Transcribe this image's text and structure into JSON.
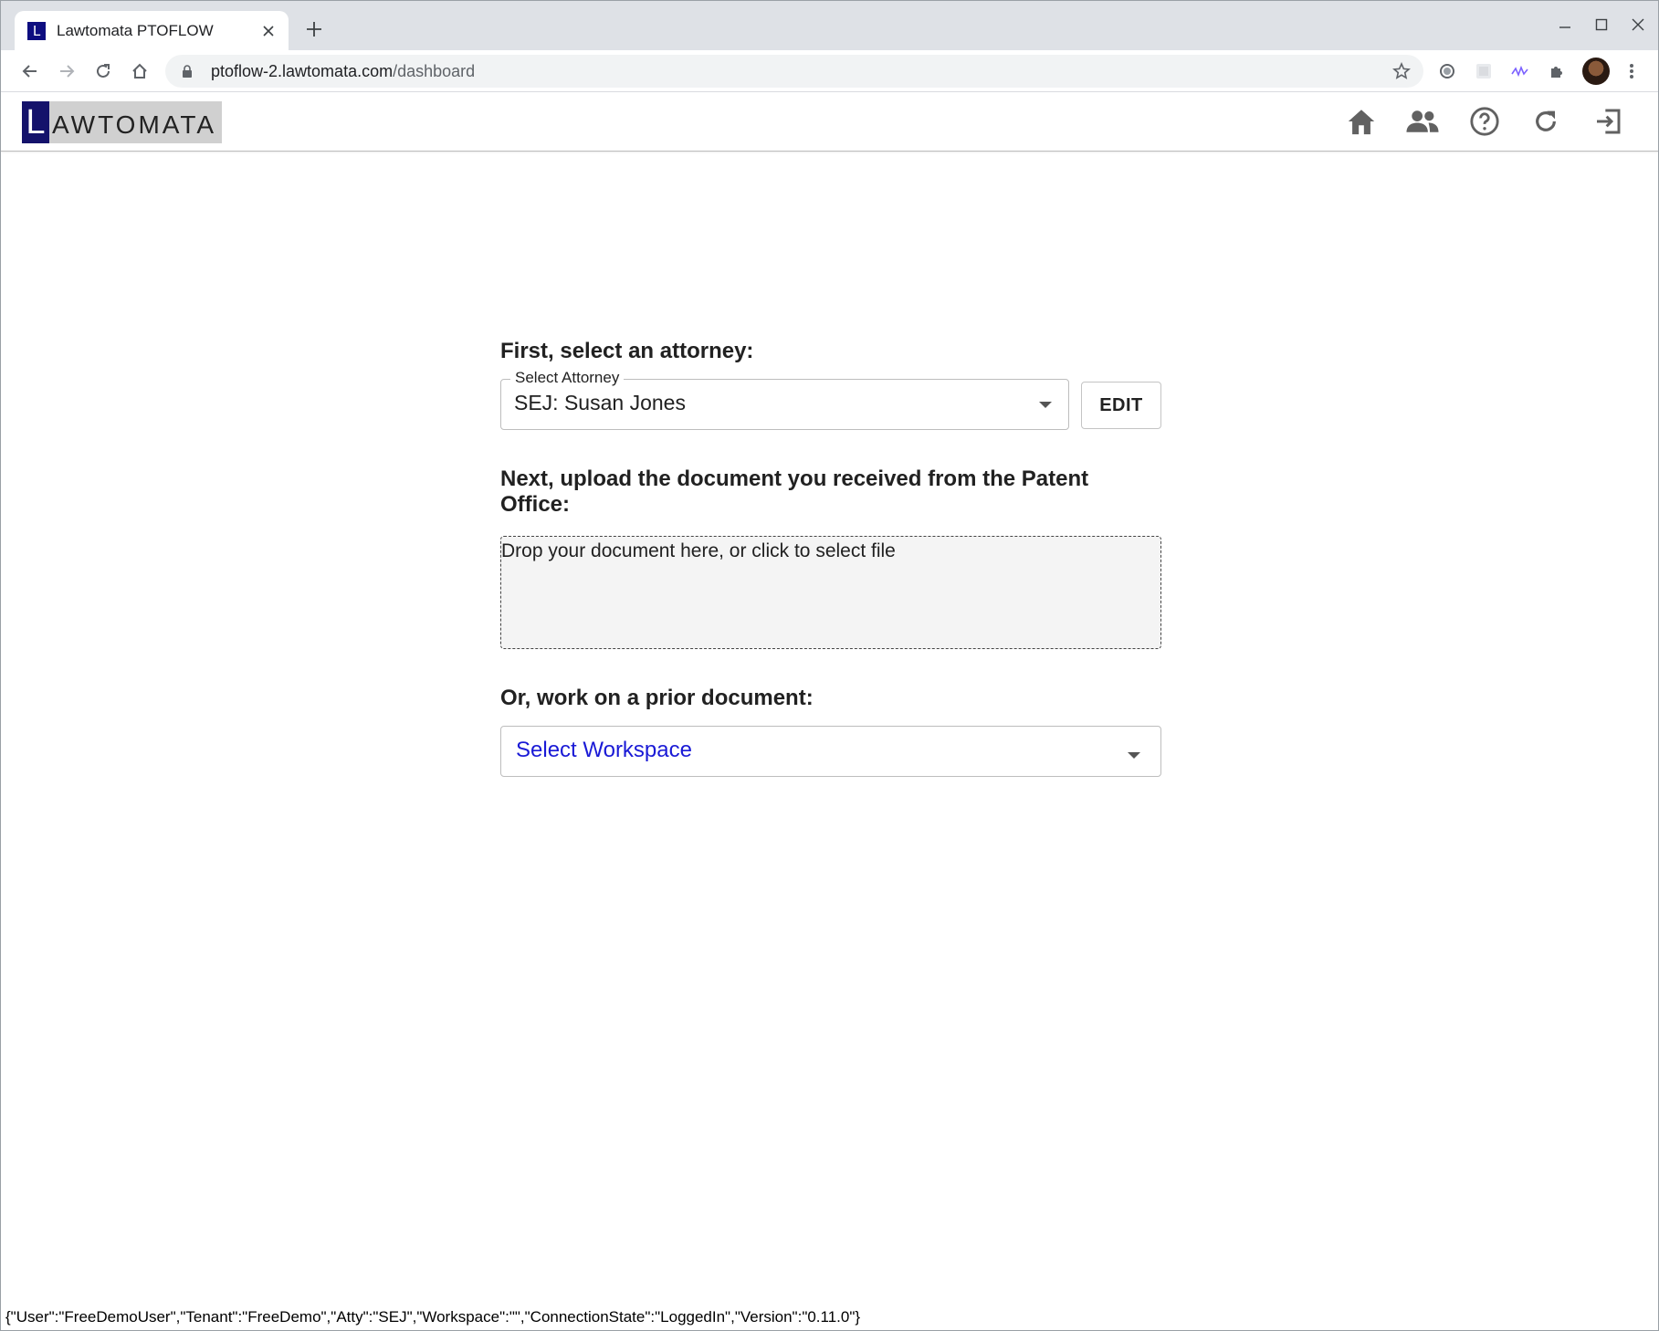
{
  "browser": {
    "tab_title": "Lawtomata PTOFLOW",
    "tab_favicon_letter": "L",
    "url_host": "ptoflow-2.lawtomata.com",
    "url_path": "/dashboard"
  },
  "app": {
    "logo_initial": "L",
    "logo_rest": "AWTOMATA",
    "logo_bg_color": "#14126b",
    "icons": [
      "home-icon",
      "people-icon",
      "help-icon",
      "refresh-icon",
      "logout-icon"
    ]
  },
  "attorney": {
    "heading": "First, select an attorney:",
    "field_label": "Select Attorney",
    "selected_value": "SEJ: Susan Jones",
    "edit_label": "EDIT"
  },
  "upload": {
    "heading": "Next, upload the document you received from the Patent Office:",
    "dropzone_text": "Drop your document here, or click to select file"
  },
  "prior": {
    "heading": "Or, work on a prior document:",
    "placeholder": "Select Workspace",
    "placeholder_color": "#1a1ad6"
  },
  "status_line": "{\"User\":\"FreeDemoUser\",\"Tenant\":\"FreeDemo\",\"Atty\":\"SEJ\",\"Workspace\":\"\",\"ConnectionState\":\"LoggedIn\",\"Version\":\"0.11.0\"}"
}
